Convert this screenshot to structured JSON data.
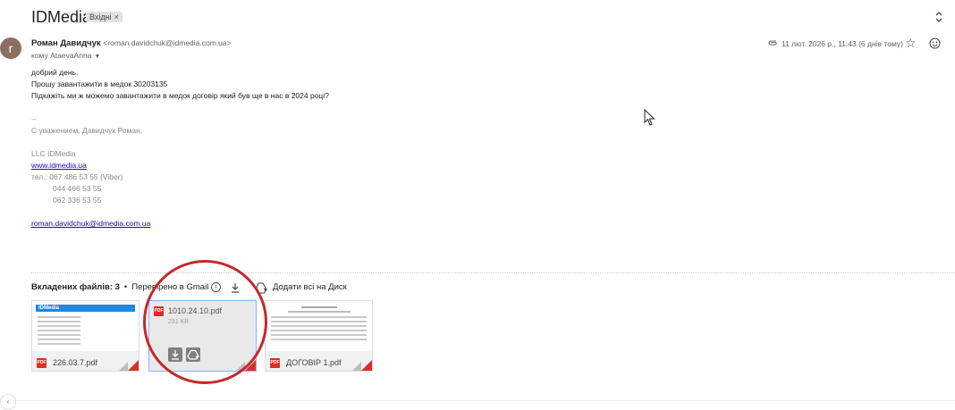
{
  "subject": "IDMedia",
  "label_badge": {
    "text": "Вхідні",
    "remove": "×"
  },
  "sender": {
    "avatar_letter": "r",
    "name": "Роман Давидчук",
    "email": "<roman.davidchuk@idmedia.com.ua>",
    "to": "кому AtaevaAnna",
    "date": "11 лют. 2026 р., 11:43 (6 днів тому)"
  },
  "body": {
    "lines": [
      "добрий день.",
      "Прошу завантажити в медок  30203135",
      "Підкажіть ми ж можемо завантажити в медок договір який був ще в нас в 2024 році?"
    ],
    "sig_dash": "--",
    "sig_regards": "С уважением, Давидчук Роман,",
    "sig_company": "LLC IDMedia",
    "sig_site": "www.idmedia.ua",
    "sig_phone1": " тел.: 067 486 53 55 (Viber)",
    "sig_phone2": "044 466 53 55",
    "sig_phone3": "062 336 53 55",
    "sig_email": "roman.davidchuk@idmedia.com.ua"
  },
  "attachments": {
    "count_label": "Вкладених файлів: 3",
    "checked_label": "Перевірено в Gmail",
    "add_drive_label": "Додати всі на Диск",
    "files": [
      {
        "name": "226.03.7.pdf"
      },
      {
        "name": "1010.24.10.pdf",
        "size": "231 KB"
      },
      {
        "name": "ДОГОВІР 1.pdf"
      }
    ],
    "pdf_tag": "PDF",
    "preview_brand": "IDMedia"
  },
  "colors": {
    "accent_red": "#c62828",
    "pdf_red": "#d93025",
    "link": "#1a0dab"
  }
}
